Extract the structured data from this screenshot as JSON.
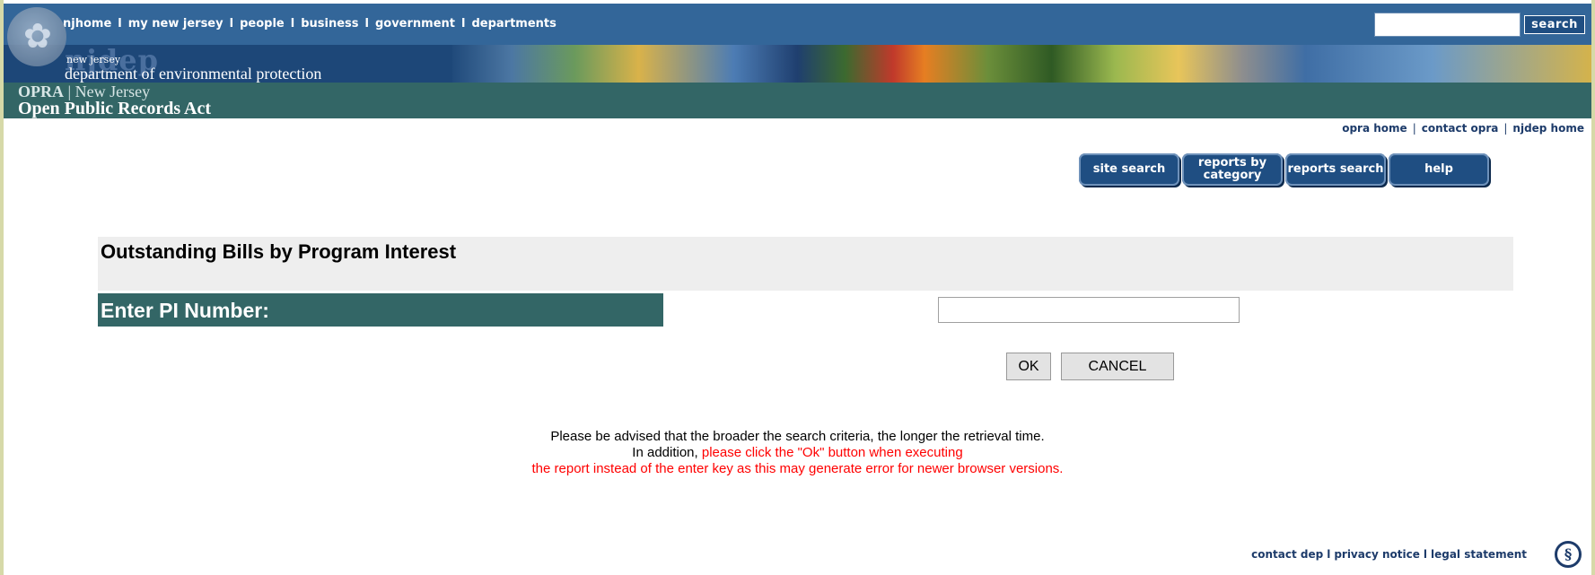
{
  "topnav": {
    "items": [
      "njhome",
      "my new jersey",
      "people",
      "business",
      "government",
      "departments"
    ],
    "separator": "l",
    "search_placeholder": "",
    "search_label": "search"
  },
  "banner": {
    "logo_text": "njdep",
    "state_small": "new jersey",
    "department": "department of environmental protection"
  },
  "opra": {
    "line1_bold": "OPRA",
    "line1_rest": "| New Jersey",
    "line2": "Open Public Records Act"
  },
  "utility_links": {
    "opra_home": "opra home",
    "contact_opra": "contact opra",
    "njdep_home": "njdep home",
    "separator": "|"
  },
  "nav_buttons": {
    "site_search": "site search",
    "reports_by_category": "reports by category",
    "reports_search": "reports search",
    "help": "help"
  },
  "form": {
    "title": "Outstanding Bills by Program Interest",
    "pi_label": "Enter PI Number:",
    "pi_value": "",
    "ok_label": "OK",
    "cancel_label": "CANCEL"
  },
  "notice": {
    "line1": "Please be advised that the broader the search criteria, the longer the retrieval time.",
    "line2_black": "In addition,",
    "line2_red": "please click the \"Ok\" button when executing",
    "line3": "the report instead of the enter key as this may generate error for newer browser versions."
  },
  "footer": {
    "contact_dep": "contact dep",
    "privacy_notice": "privacy notice",
    "legal_statement": "legal statement",
    "separator": "l"
  },
  "colors": {
    "nav_blue": "#336699",
    "teal": "#336666",
    "button_blue": "#1f4e82",
    "link_navy": "#1d3b6a",
    "notice_red": "#ff0000"
  }
}
